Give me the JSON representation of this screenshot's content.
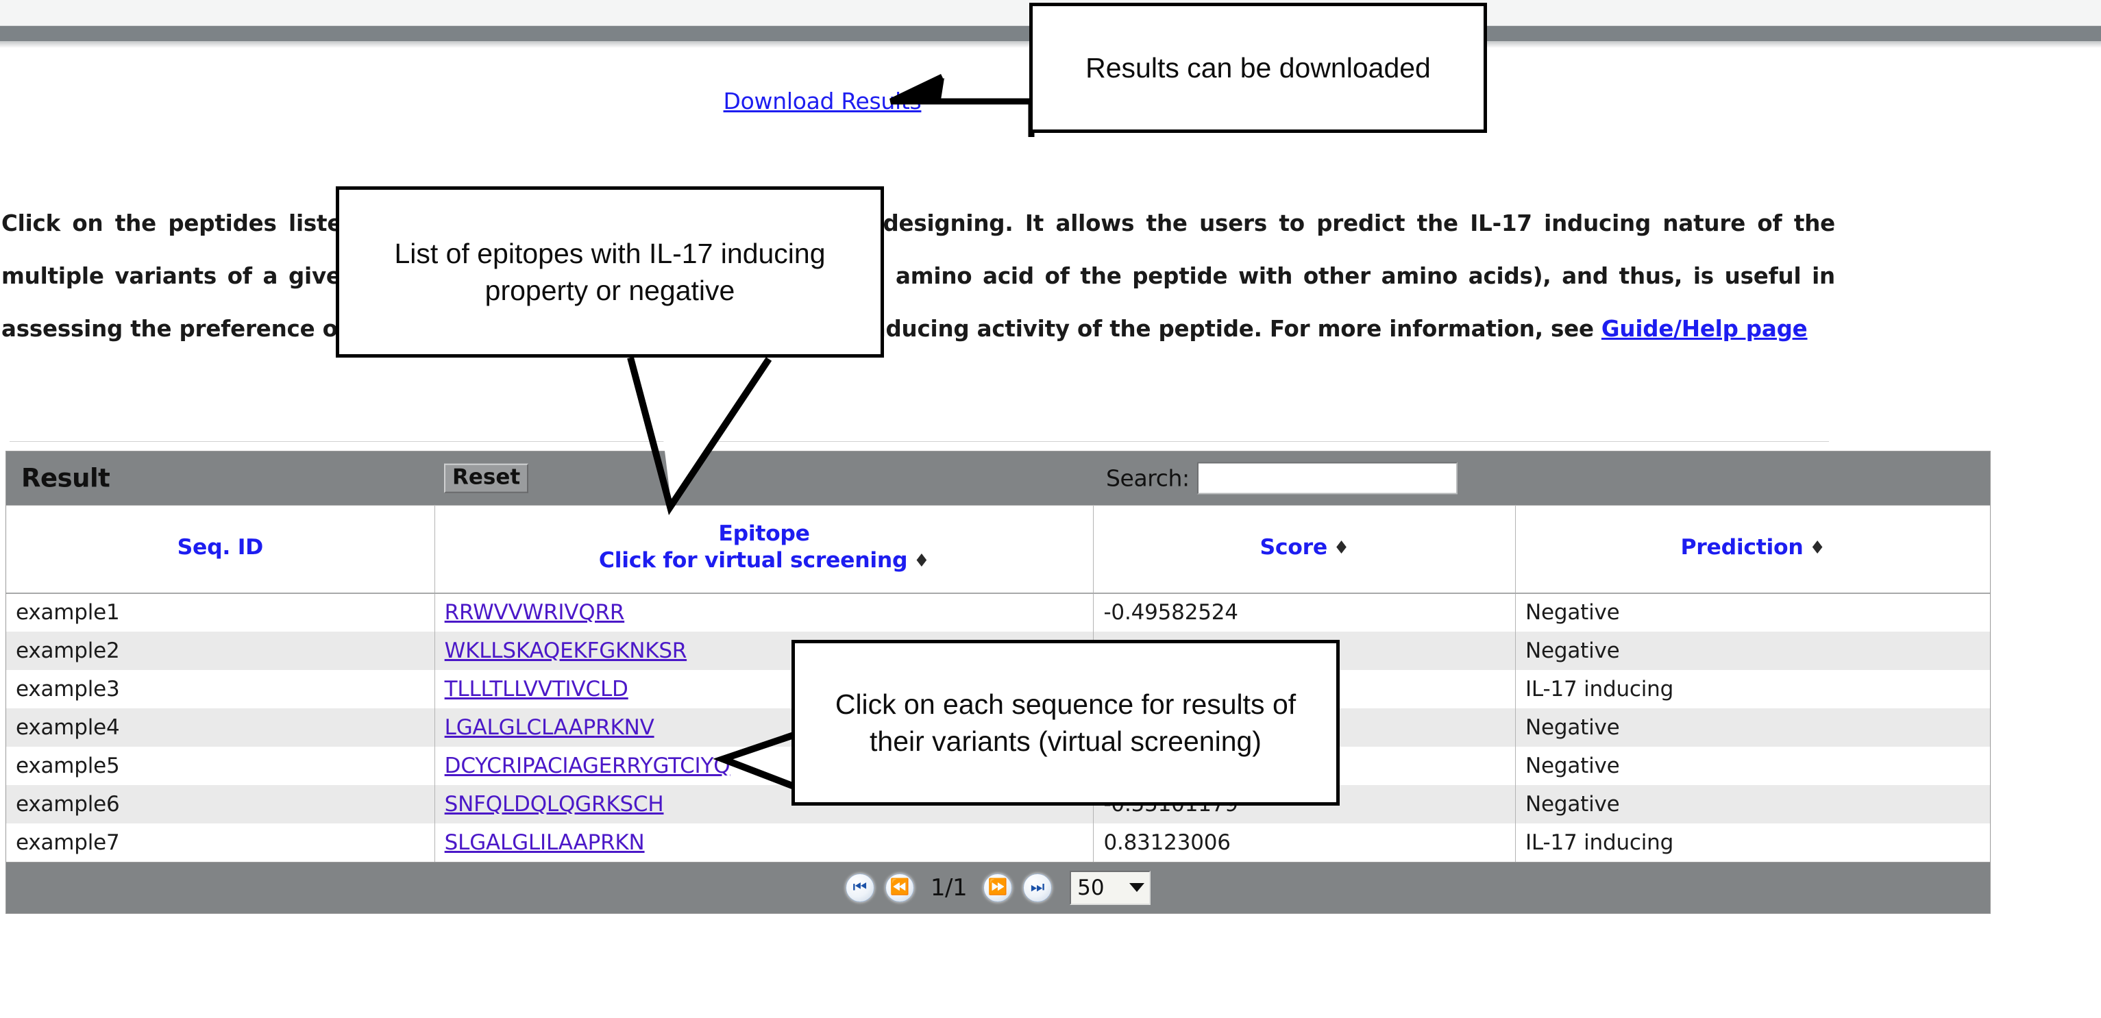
{
  "page": {
    "download_link": "Download Results",
    "intro_part1": "Click on the peptides listed below for virtual screening for vaccine designing. It allows the users to predict the IL-17 inducing nature of the multiple variants of a given peptide (generated by substituting each amino acid of the peptide with other amino acids), and thus, is useful in assessing the preference of each amino acid in modulating the IL-17 inducing activity of the peptide. For more information, see ",
    "guide_link": "Guide/Help page"
  },
  "toolbar": {
    "title": "Result",
    "reset_label": "Reset",
    "search_label": "Search:",
    "search_value": "",
    "search_placeholder": ""
  },
  "table": {
    "columns": [
      {
        "id": "seq-id",
        "label": "Seq. ID",
        "sublabel": "",
        "sortable": false
      },
      {
        "id": "epitope",
        "label": "Epitope",
        "sublabel": "Click for virtual screening",
        "sortable": true
      },
      {
        "id": "score",
        "label": "Score",
        "sublabel": "",
        "sortable": true
      },
      {
        "id": "prediction",
        "label": "Prediction",
        "sublabel": "",
        "sortable": true
      }
    ],
    "sort_icon": "♦",
    "rows": [
      {
        "seq_id": "example1",
        "epitope": "RRWVVWRIVQRR",
        "score": "-0.49582524",
        "prediction": "Negative"
      },
      {
        "seq_id": "example2",
        "epitope": "WKLLSKAQEKFGKNKSR",
        "score": "",
        "prediction": "Negative"
      },
      {
        "seq_id": "example3",
        "epitope": "TLLLTLLVVTIVCLD",
        "score": "",
        "prediction": "IL-17 inducing"
      },
      {
        "seq_id": "example4",
        "epitope": "LGALGLCLAAPRKNV",
        "score": "",
        "prediction": "Negative"
      },
      {
        "seq_id": "example5",
        "epitope": "DCYCRIPACIAGERRYGTCIYQ",
        "score": "",
        "prediction": "Negative"
      },
      {
        "seq_id": "example6",
        "epitope": "SNFQLDQLQGRKSCH",
        "score": "-0.55101179",
        "prediction": "Negative"
      },
      {
        "seq_id": "example7",
        "epitope": "SLGALGLILAAPRKN",
        "score": "0.83123006",
        "prediction": "IL-17 inducing"
      }
    ]
  },
  "pagination": {
    "first_icon": "⏮",
    "prev_icon": "⏪",
    "page_indicator": "1/1",
    "next_icon": "⏩",
    "last_icon": "⏭",
    "page_size": "50"
  },
  "annotations": {
    "callout1": "Results can be downloaded",
    "callout2": "List of epitopes with IL-17 inducing property or negative",
    "callout3": "Click on each sequence for results of their variants (virtual screening)"
  },
  "colors": {
    "link": "#1d1df0",
    "epitope_link": "#4b18c8",
    "header_bar": "#818486",
    "chrome_band": "#7d8387",
    "row_alt": "#eaeaea"
  }
}
